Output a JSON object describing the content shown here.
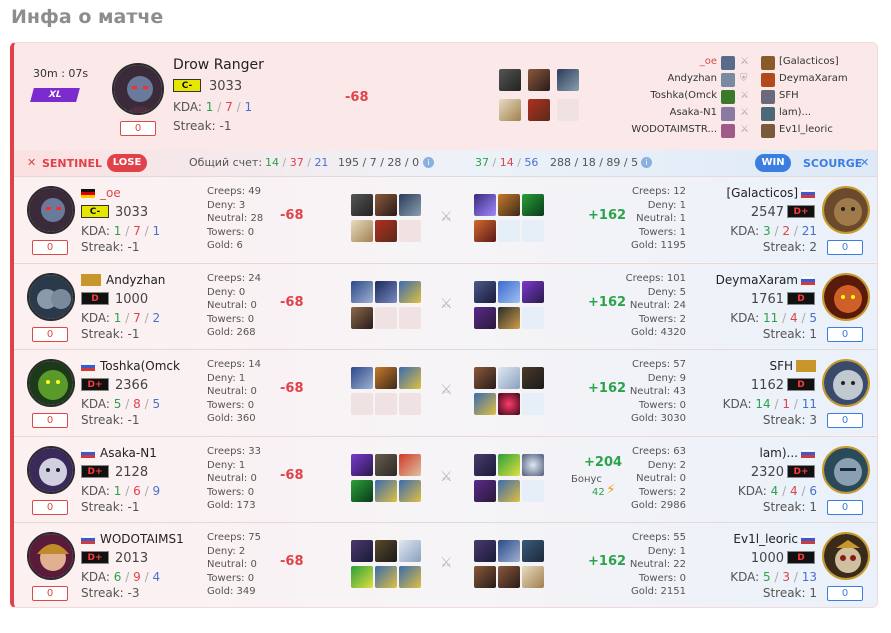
{
  "page": {
    "title": "Инфа о матче"
  },
  "summary": {
    "time": "30m : 07s",
    "mode": "XL",
    "hero": "Drow Ranger",
    "rank": "C-",
    "rating": "3033",
    "kda": {
      "k": "1",
      "d": "7",
      "a": "1"
    },
    "kda_label": "KDA:",
    "streak_text": "Streak: -1",
    "streak_box": "0",
    "delta": "-68",
    "roster_left": [
      "_oe",
      "Andyzhan",
      "Toshka(Omck",
      "Asaka-N1",
      "WODOTAIMSTR..."
    ],
    "roster_right": [
      "[Galacticos]",
      "DeymaXaram",
      "SFH",
      "lam)...",
      "Ev1l_leoric"
    ]
  },
  "scorebar": {
    "sentinel": "SENTINEL",
    "lose": "LOSE",
    "total_label": "Общий счет:",
    "left_kda": [
      "14",
      "37",
      "21"
    ],
    "left_stats": "195 / 7 / 28 / 0",
    "right_kda": [
      "37",
      "14",
      "56"
    ],
    "right_stats": "288 / 18 / 89 / 5",
    "win": "WIN",
    "scourge": "SCOURGE"
  },
  "labels": {
    "creeps": "Creeps",
    "deny": "Deny",
    "neutral": "Neutral",
    "towers": "Towers",
    "gold": "Gold",
    "bonus": "Бонус"
  },
  "rows": [
    {
      "left": {
        "name": "_oe",
        "rank": "C-",
        "rating": "3033",
        "k": "1",
        "d": "7",
        "a": "1",
        "streak": "Streak: -1",
        "box": "0",
        "delta": "-68",
        "stats": [
          "Creeps: 49",
          "Deny: 3",
          "Neutral: 28",
          "Towers: 0",
          "Gold: 6"
        ]
      },
      "right": {
        "name": "[Galacticos]",
        "rank": "D+",
        "rating": "2547",
        "k": "3",
        "d": "2",
        "a": "21",
        "streak": "Streak: 2",
        "box": "0",
        "delta": "+162",
        "stats": [
          "Creeps: 12",
          "Deny: 1",
          "Neutral: 1",
          "Towers: 1",
          "Gold: 1195"
        ]
      }
    },
    {
      "left": {
        "name": "Andyzhan",
        "rank": "D",
        "rating": "1000",
        "k": "1",
        "d": "7",
        "a": "2",
        "streak": "Streak: -1",
        "box": "0",
        "delta": "-68",
        "stats": [
          "Creeps: 24",
          "Deny: 0",
          "Neutral: 0",
          "Towers: 0",
          "Gold: 268"
        ]
      },
      "right": {
        "name": "DeymaXaram",
        "rank": "D",
        "rating": "1761",
        "k": "11",
        "d": "4",
        "a": "5",
        "streak": "Streak: 1",
        "box": "0",
        "delta": "+162",
        "stats": [
          "Creeps: 101",
          "Deny: 5",
          "Neutral: 24",
          "Towers: 2",
          "Gold: 4320"
        ]
      }
    },
    {
      "left": {
        "name": "Toshka(Omck",
        "rank": "D+",
        "rating": "2366",
        "k": "5",
        "d": "8",
        "a": "5",
        "streak": "Streak: -1",
        "box": "0",
        "delta": "-68",
        "stats": [
          "Creeps: 14",
          "Deny: 1",
          "Neutral: 0",
          "Towers: 0",
          "Gold: 360"
        ]
      },
      "right": {
        "name": "SFH",
        "rank": "D",
        "rating": "1162",
        "k": "14",
        "d": "1",
        "a": "11",
        "streak": "Streak: 3",
        "box": "0",
        "delta": "+162",
        "stats": [
          "Creeps: 57",
          "Deny: 9",
          "Neutral: 43",
          "Towers: 0",
          "Gold: 3030"
        ]
      }
    },
    {
      "left": {
        "name": "Asaka-N1",
        "rank": "D+",
        "rating": "2128",
        "k": "1",
        "d": "6",
        "a": "9",
        "streak": "Streak: -1",
        "box": "0",
        "delta": "-68",
        "stats": [
          "Creeps: 33",
          "Deny: 1",
          "Neutral: 0",
          "Towers: 0",
          "Gold: 173"
        ]
      },
      "right": {
        "name": "lam)...",
        "rank": "D+",
        "rating": "2320",
        "k": "4",
        "d": "4",
        "a": "6",
        "streak": "Streak: 1",
        "box": "0",
        "delta": "+204",
        "bonus": "42",
        "stats": [
          "Creeps: 63",
          "Deny: 2",
          "Neutral: 0",
          "Towers: 2",
          "Gold: 2986"
        ]
      }
    },
    {
      "left": {
        "name": "WODOTAIMS1",
        "rank": "D+",
        "rating": "2013",
        "k": "6",
        "d": "9",
        "a": "4",
        "streak": "Streak: -3",
        "box": "0",
        "delta": "-68",
        "stats": [
          "Creeps: 75",
          "Deny: 2",
          "Neutral: 0",
          "Towers: 0",
          "Gold: 349"
        ]
      },
      "right": {
        "name": "Ev1l_leoric",
        "rank": "D",
        "rating": "1000",
        "k": "5",
        "d": "3",
        "a": "13",
        "streak": "Streak: 1",
        "box": "0",
        "delta": "+162",
        "stats": [
          "Creeps: 55",
          "Deny: 1",
          "Neutral: 22",
          "Towers: 0",
          "Gold: 2151"
        ]
      }
    }
  ],
  "colors": {
    "sentinel": "#e0424a",
    "scourge": "#3b7de0",
    "kills": "#2aa34a",
    "deaths": "#e0424a",
    "assists": "#4a6fd0"
  }
}
